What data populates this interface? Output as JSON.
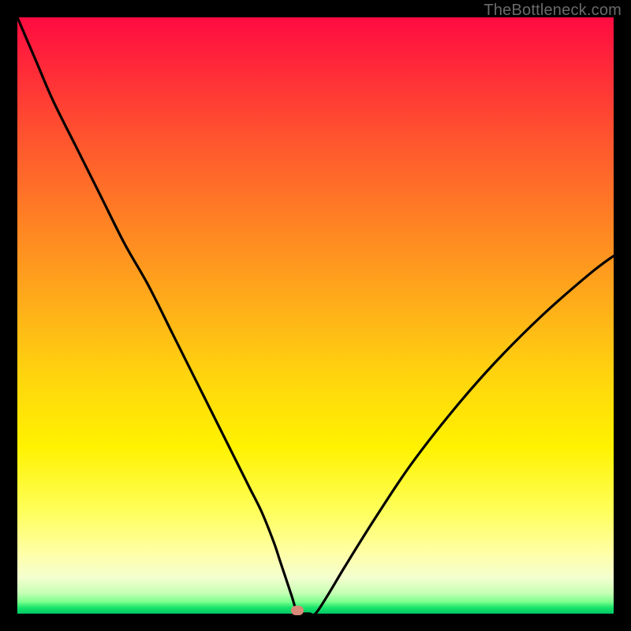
{
  "watermark": "TheBottleneck.com",
  "colors": {
    "curve_stroke": "#000000",
    "marker_fill": "#d98a78",
    "frame_bg": "#000000"
  },
  "chart_data": {
    "type": "line",
    "title": "",
    "xlabel": "",
    "ylabel": "",
    "xlim": [
      0,
      100
    ],
    "ylim": [
      0,
      100
    ],
    "grid": false,
    "legend": false,
    "annotations": [
      {
        "kind": "marker",
        "x": 47,
        "y": 0,
        "label": "minimum"
      }
    ],
    "series": [
      {
        "name": "bottleneck-curve",
        "x": [
          0,
          3,
          6,
          10,
          14,
          18,
          22,
          26,
          30,
          34,
          37,
          39,
          41,
          43,
          44,
          45,
          46,
          47,
          48,
          49,
          50,
          52,
          55,
          60,
          66,
          73,
          80,
          88,
          96,
          100
        ],
        "y": [
          100,
          93,
          86,
          78,
          70,
          62,
          55,
          47,
          39,
          31,
          25,
          21,
          17,
          12,
          9,
          6,
          3,
          0,
          0,
          0,
          0,
          3,
          8,
          16,
          25,
          34,
          42,
          50,
          57,
          60
        ]
      }
    ]
  }
}
